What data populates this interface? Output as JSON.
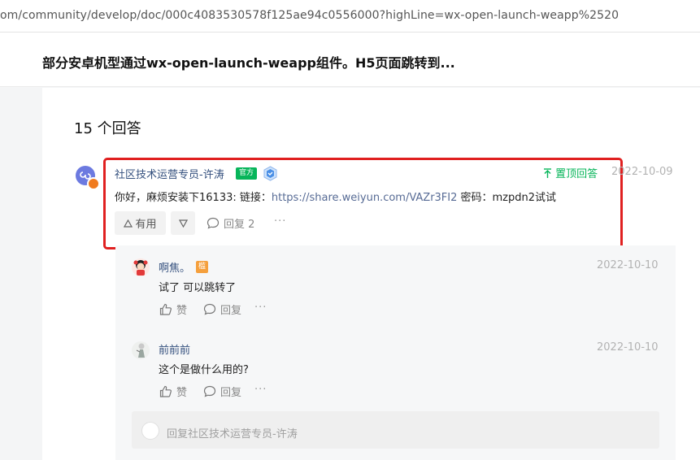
{
  "browser": {
    "url": "om/community/develop/doc/000c4083530578f125ae94c0556000?highLine=wx-open-launch-weapp%2520"
  },
  "question": {
    "title": "部分安卓机型通过wx-open-launch-weapp组件。H5页面跳转到..."
  },
  "answers_header": "15 个回答",
  "answer": {
    "author": "社区技术运营专员-许涛",
    "official_badge": "官方",
    "pinned_label": "置顶回答",
    "date": "2022-10-09",
    "text_prefix": "你好，麻烦安装下16133: 链接：",
    "link": "https://share.weiyun.com/VAZr3FI2",
    "text_suffix": " 密码：mzpdn2试试",
    "useful_label": "有用",
    "reply_label": "回复 2",
    "more": "···"
  },
  "replies": [
    {
      "author": "啊焦。",
      "tag": "槛",
      "date": "2022-10-10",
      "text": "试了 可以跳转了",
      "like_label": "赞",
      "reply_label": "回复",
      "more": "···"
    },
    {
      "author": "前前前",
      "date": "2022-10-10",
      "text": "这个是做什么用的?",
      "like_label": "赞",
      "reply_label": "回复",
      "more": "···"
    }
  ],
  "reply_input": {
    "placeholder": "回复社区技术运营专员-许涛"
  },
  "colors": {
    "link": "#576b95",
    "name": "#34507e",
    "official": "#07b55a",
    "highlight": "#e02020"
  }
}
